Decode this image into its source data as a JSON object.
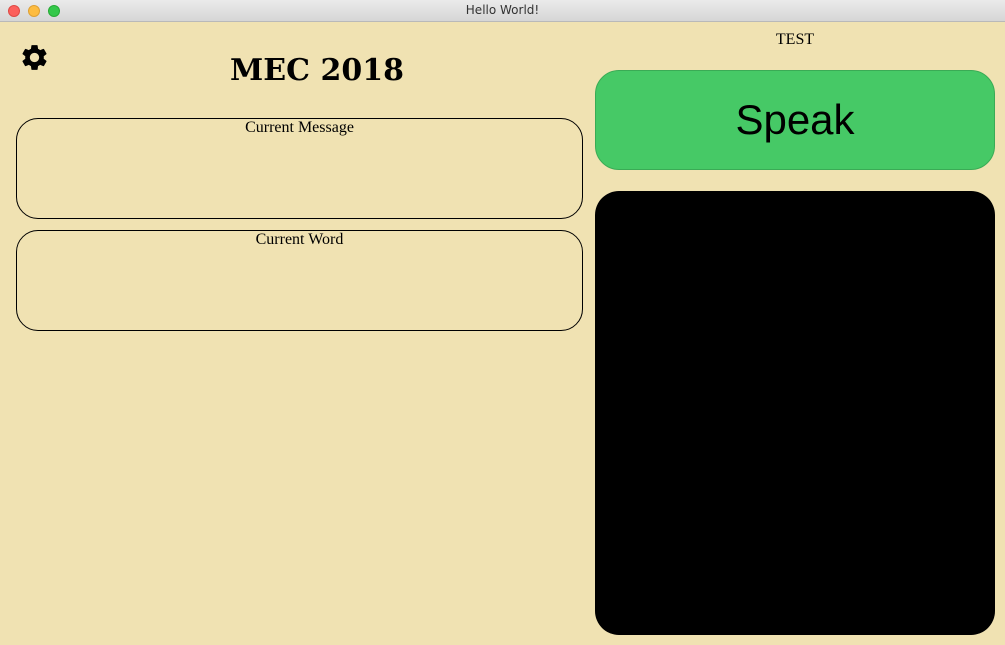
{
  "window": {
    "title": "Hello World!"
  },
  "app": {
    "title": "MEC 2018",
    "settings_icon": "gear-icon"
  },
  "message_panel": {
    "label": "Current Message",
    "value": ""
  },
  "word_panel": {
    "label": "Current Word",
    "value": ""
  },
  "right_panel": {
    "test_label": "TEST",
    "speak_label": "Speak",
    "speak_color": "#46c966",
    "video_color": "#000000"
  },
  "colors": {
    "background": "#f0e2b2",
    "accent": "#46c966"
  }
}
